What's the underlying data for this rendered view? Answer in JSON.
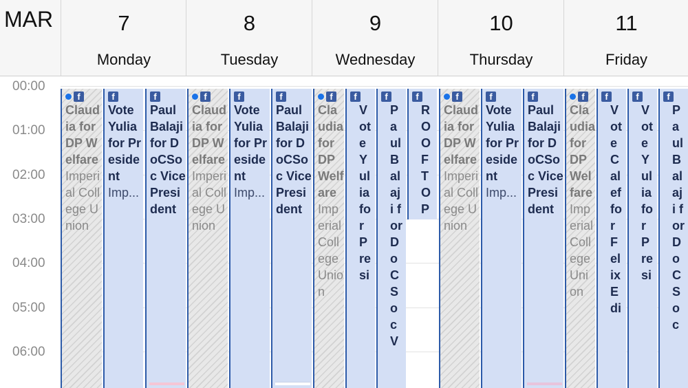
{
  "header": {
    "month": "MAR",
    "days": [
      {
        "num": "7",
        "name": "Monday"
      },
      {
        "num": "8",
        "name": "Tuesday"
      },
      {
        "num": "9",
        "name": "Wednesday"
      },
      {
        "num": "10",
        "name": "Thursday"
      },
      {
        "num": "11",
        "name": "Friday"
      }
    ]
  },
  "times": [
    "00:00",
    "01:00",
    "02:00",
    "03:00",
    "04:00",
    "05:00",
    "06:00"
  ],
  "events": {
    "claudia": {
      "title": "Claudia for DP Welfare",
      "location": "Imperial College Union"
    },
    "claudia_wide": {
      "title": "Claudia for DP Welfare",
      "location": "Imperial College Union"
    },
    "vote_yulia": {
      "title": "Vote Yulia for President",
      "location": "Imp..."
    },
    "paul_balaji": {
      "title": "Paul Balaji for DoCSoc Vice President"
    },
    "vote_yulia_wed": {
      "title": "Vote Yulia for Presi"
    },
    "paul_balaji_wed": {
      "title": "Paul Balaji for DoCSoc V"
    },
    "rooftop": {
      "title": "ROOFTOP"
    },
    "vote_calef": {
      "title": "Vote Calef for Felix Edi"
    },
    "vote_yulia_fri": {
      "title": "Vote Yulia for Presi"
    },
    "paul_balaji_fri": {
      "title": "Paul Balaji for DoCSoc"
    }
  },
  "colors": {
    "event_bg": "#d4dff5",
    "event_border": "#2c5aa8",
    "facebook": "#3a5ba0",
    "dot": "#1a73e8"
  }
}
